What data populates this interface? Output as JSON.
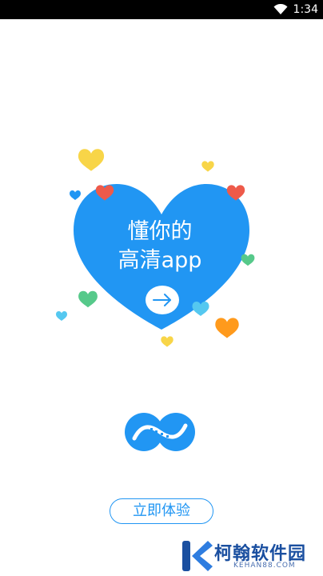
{
  "status_bar": {
    "time": "1:34"
  },
  "hero": {
    "line1": "懂你的",
    "line2": "高清app"
  },
  "cta": {
    "label": "立即体验"
  },
  "watermark": {
    "name": "柯翰软件园",
    "domain": "KEHAN88.COM"
  },
  "colors": {
    "brand_blue": "#2196f3",
    "heart_yellow": "#f8d548",
    "heart_red": "#ee5a4a",
    "heart_green": "#56c98a",
    "heart_cyan": "#55c8f0",
    "heart_orange": "#ff9a1c"
  }
}
